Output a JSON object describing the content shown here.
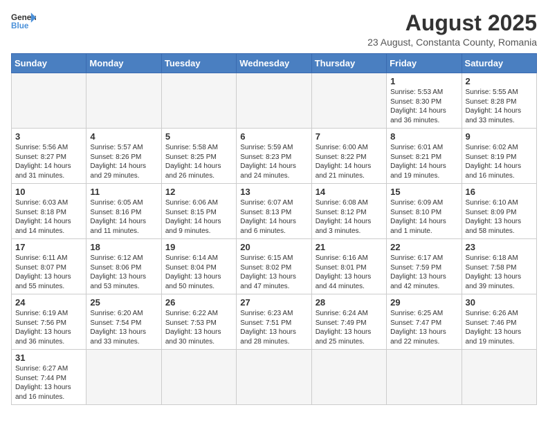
{
  "logo": {
    "text_general": "General",
    "text_blue": "Blue"
  },
  "header": {
    "month_year": "August 2025",
    "subtitle": "23 August, Constanta County, Romania"
  },
  "days_of_week": [
    "Sunday",
    "Monday",
    "Tuesday",
    "Wednesday",
    "Thursday",
    "Friday",
    "Saturday"
  ],
  "weeks": [
    [
      {
        "day": "",
        "info": ""
      },
      {
        "day": "",
        "info": ""
      },
      {
        "day": "",
        "info": ""
      },
      {
        "day": "",
        "info": ""
      },
      {
        "day": "",
        "info": ""
      },
      {
        "day": "1",
        "info": "Sunrise: 5:53 AM\nSunset: 8:30 PM\nDaylight: 14 hours and 36 minutes."
      },
      {
        "day": "2",
        "info": "Sunrise: 5:55 AM\nSunset: 8:28 PM\nDaylight: 14 hours and 33 minutes."
      }
    ],
    [
      {
        "day": "3",
        "info": "Sunrise: 5:56 AM\nSunset: 8:27 PM\nDaylight: 14 hours and 31 minutes."
      },
      {
        "day": "4",
        "info": "Sunrise: 5:57 AM\nSunset: 8:26 PM\nDaylight: 14 hours and 29 minutes."
      },
      {
        "day": "5",
        "info": "Sunrise: 5:58 AM\nSunset: 8:25 PM\nDaylight: 14 hours and 26 minutes."
      },
      {
        "day": "6",
        "info": "Sunrise: 5:59 AM\nSunset: 8:23 PM\nDaylight: 14 hours and 24 minutes."
      },
      {
        "day": "7",
        "info": "Sunrise: 6:00 AM\nSunset: 8:22 PM\nDaylight: 14 hours and 21 minutes."
      },
      {
        "day": "8",
        "info": "Sunrise: 6:01 AM\nSunset: 8:21 PM\nDaylight: 14 hours and 19 minutes."
      },
      {
        "day": "9",
        "info": "Sunrise: 6:02 AM\nSunset: 8:19 PM\nDaylight: 14 hours and 16 minutes."
      }
    ],
    [
      {
        "day": "10",
        "info": "Sunrise: 6:03 AM\nSunset: 8:18 PM\nDaylight: 14 hours and 14 minutes."
      },
      {
        "day": "11",
        "info": "Sunrise: 6:05 AM\nSunset: 8:16 PM\nDaylight: 14 hours and 11 minutes."
      },
      {
        "day": "12",
        "info": "Sunrise: 6:06 AM\nSunset: 8:15 PM\nDaylight: 14 hours and 9 minutes."
      },
      {
        "day": "13",
        "info": "Sunrise: 6:07 AM\nSunset: 8:13 PM\nDaylight: 14 hours and 6 minutes."
      },
      {
        "day": "14",
        "info": "Sunrise: 6:08 AM\nSunset: 8:12 PM\nDaylight: 14 hours and 3 minutes."
      },
      {
        "day": "15",
        "info": "Sunrise: 6:09 AM\nSunset: 8:10 PM\nDaylight: 14 hours and 1 minute."
      },
      {
        "day": "16",
        "info": "Sunrise: 6:10 AM\nSunset: 8:09 PM\nDaylight: 13 hours and 58 minutes."
      }
    ],
    [
      {
        "day": "17",
        "info": "Sunrise: 6:11 AM\nSunset: 8:07 PM\nDaylight: 13 hours and 55 minutes."
      },
      {
        "day": "18",
        "info": "Sunrise: 6:12 AM\nSunset: 8:06 PM\nDaylight: 13 hours and 53 minutes."
      },
      {
        "day": "19",
        "info": "Sunrise: 6:14 AM\nSunset: 8:04 PM\nDaylight: 13 hours and 50 minutes."
      },
      {
        "day": "20",
        "info": "Sunrise: 6:15 AM\nSunset: 8:02 PM\nDaylight: 13 hours and 47 minutes."
      },
      {
        "day": "21",
        "info": "Sunrise: 6:16 AM\nSunset: 8:01 PM\nDaylight: 13 hours and 44 minutes."
      },
      {
        "day": "22",
        "info": "Sunrise: 6:17 AM\nSunset: 7:59 PM\nDaylight: 13 hours and 42 minutes."
      },
      {
        "day": "23",
        "info": "Sunrise: 6:18 AM\nSunset: 7:58 PM\nDaylight: 13 hours and 39 minutes."
      }
    ],
    [
      {
        "day": "24",
        "info": "Sunrise: 6:19 AM\nSunset: 7:56 PM\nDaylight: 13 hours and 36 minutes."
      },
      {
        "day": "25",
        "info": "Sunrise: 6:20 AM\nSunset: 7:54 PM\nDaylight: 13 hours and 33 minutes."
      },
      {
        "day": "26",
        "info": "Sunrise: 6:22 AM\nSunset: 7:53 PM\nDaylight: 13 hours and 30 minutes."
      },
      {
        "day": "27",
        "info": "Sunrise: 6:23 AM\nSunset: 7:51 PM\nDaylight: 13 hours and 28 minutes."
      },
      {
        "day": "28",
        "info": "Sunrise: 6:24 AM\nSunset: 7:49 PM\nDaylight: 13 hours and 25 minutes."
      },
      {
        "day": "29",
        "info": "Sunrise: 6:25 AM\nSunset: 7:47 PM\nDaylight: 13 hours and 22 minutes."
      },
      {
        "day": "30",
        "info": "Sunrise: 6:26 AM\nSunset: 7:46 PM\nDaylight: 13 hours and 19 minutes."
      }
    ],
    [
      {
        "day": "31",
        "info": "Sunrise: 6:27 AM\nSunset: 7:44 PM\nDaylight: 13 hours and 16 minutes."
      },
      {
        "day": "",
        "info": ""
      },
      {
        "day": "",
        "info": ""
      },
      {
        "day": "",
        "info": ""
      },
      {
        "day": "",
        "info": ""
      },
      {
        "day": "",
        "info": ""
      },
      {
        "day": "",
        "info": ""
      }
    ]
  ]
}
